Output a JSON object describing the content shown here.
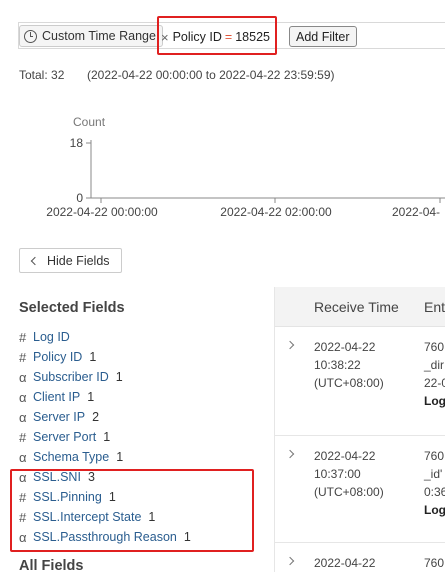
{
  "filters": {
    "time_range_label": "Custom Time Range",
    "policy_chip": {
      "remove_symbol": "×",
      "field": "Policy ID",
      "operator": "=",
      "value": "18525"
    },
    "add_filter_label": "Add Filter"
  },
  "summary": {
    "total": "Total: 32",
    "range": "(2022-04-22 00:00:00 to 2022-04-22 23:59:59)"
  },
  "chart_data": {
    "type": "bar",
    "ylabel": "Count",
    "yticks": [
      "18",
      "0"
    ],
    "ylim": [
      0,
      18
    ],
    "xticks": [
      "2022-04-22 00:00:00",
      "2022-04-22 02:00:00",
      "2022-04-"
    ],
    "values": []
  },
  "hide_fields_label": "Hide Fields",
  "fields_panel": {
    "selected_title": "Selected Fields",
    "all_title": "All Fields",
    "fields": [
      {
        "type": "#",
        "name": "Log ID",
        "count": ""
      },
      {
        "type": "#",
        "name": "Policy ID",
        "count": "1"
      },
      {
        "type": "α",
        "name": "Subscriber ID",
        "count": "1"
      },
      {
        "type": "α",
        "name": "Client IP",
        "count": "1"
      },
      {
        "type": "α",
        "name": "Server IP",
        "count": "2"
      },
      {
        "type": "#",
        "name": "Server Port",
        "count": "1"
      },
      {
        "type": "α",
        "name": "Schema Type",
        "count": "1"
      },
      {
        "type": "α",
        "name": "SSL.SNI",
        "count": "3"
      },
      {
        "type": "#",
        "name": "SSL.Pinning",
        "count": "1"
      },
      {
        "type": "#",
        "name": "SSL.Intercept State",
        "count": "1"
      },
      {
        "type": "α",
        "name": "SSL.Passthrough Reason",
        "count": "1"
      }
    ]
  },
  "table": {
    "columns": [
      "Receive Time",
      "Ent"
    ],
    "rows": [
      {
        "date": "2022-04-22",
        "time": "10:38:22",
        "tz": "(UTC+08:00)",
        "e1": "760",
        "e2": "_dir",
        "e3": "22-0",
        "e4": "Log"
      },
      {
        "date": "2022-04-22",
        "time": "10:37:00",
        "tz": "(UTC+08:00)",
        "e1": "760",
        "e2": "_id'",
        "e3": "0:36",
        "e4": "Log"
      },
      {
        "date": "2022-04-22",
        "time": "",
        "tz": "",
        "e1": "760",
        "e2": "",
        "e3": "",
        "e4": ""
      }
    ]
  },
  "colors": {
    "highlight": "#e02020",
    "link": "#2a5d8f",
    "operator": "#e0563b"
  }
}
